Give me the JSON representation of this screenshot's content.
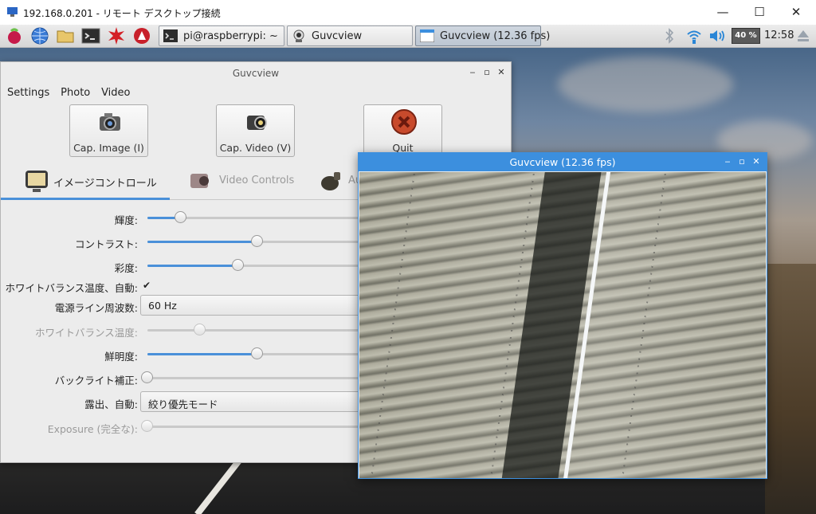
{
  "rdp": {
    "title": "192.168.0.201 - リモート デスクトップ接続",
    "minimize": "—",
    "maximize": "☐",
    "close": "✕"
  },
  "panel": {
    "launchers": [
      "raspberry-menu-icon",
      "web-browser-icon",
      "file-manager-icon",
      "terminal-icon",
      "mathematica-icon",
      "wolfram-icon"
    ],
    "tasks": [
      {
        "label": "pi@raspberrypi: ~",
        "icon": "terminal-icon"
      },
      {
        "label": "Guvcview",
        "icon": "webcam-icon"
      },
      {
        "label": "Guvcview  (12.36 fps)",
        "icon": "window-icon"
      }
    ],
    "battery": "40 %",
    "clock": "12:58"
  },
  "main_window": {
    "title": "Guvcview",
    "menu": [
      "Settings",
      "Photo",
      "Video"
    ],
    "buttons": {
      "cap_image": "Cap. Image (I)",
      "cap_video": "Cap. Video (V)",
      "quit": "Quit"
    },
    "tabs": [
      {
        "label": "イメージコントロール"
      },
      {
        "label": "Video Controls"
      },
      {
        "label": "Au"
      }
    ],
    "controls": {
      "brightness": {
        "label": "輝度:",
        "value": 0.14
      },
      "contrast": {
        "label": "コントラスト:",
        "value": 0.46
      },
      "saturation": {
        "label": "彩度:",
        "value": 0.38
      },
      "wb_auto": {
        "label": "ホワイトバランス温度、自動:",
        "checked": "✔"
      },
      "power_line": {
        "label": "電源ライン周波数:",
        "value": "60 Hz"
      },
      "wb_temp": {
        "label": "ホワイトバランス温度:",
        "value": 0.22
      },
      "sharpness": {
        "label": "鮮明度:",
        "value": 0.46
      },
      "backlight": {
        "label": "バックライト補正:",
        "value": 0.0
      },
      "exposure_auto": {
        "label": "露出、自動:",
        "value": "絞り優先モード"
      },
      "exposure_abs": {
        "label": "Exposure (完全な):",
        "value": 0.0
      }
    }
  },
  "preview_window": {
    "title": "Guvcview  (12.36 fps)"
  },
  "colors": {
    "accent": "#4a90d9",
    "preview_titlebar": "#3c8fde"
  }
}
